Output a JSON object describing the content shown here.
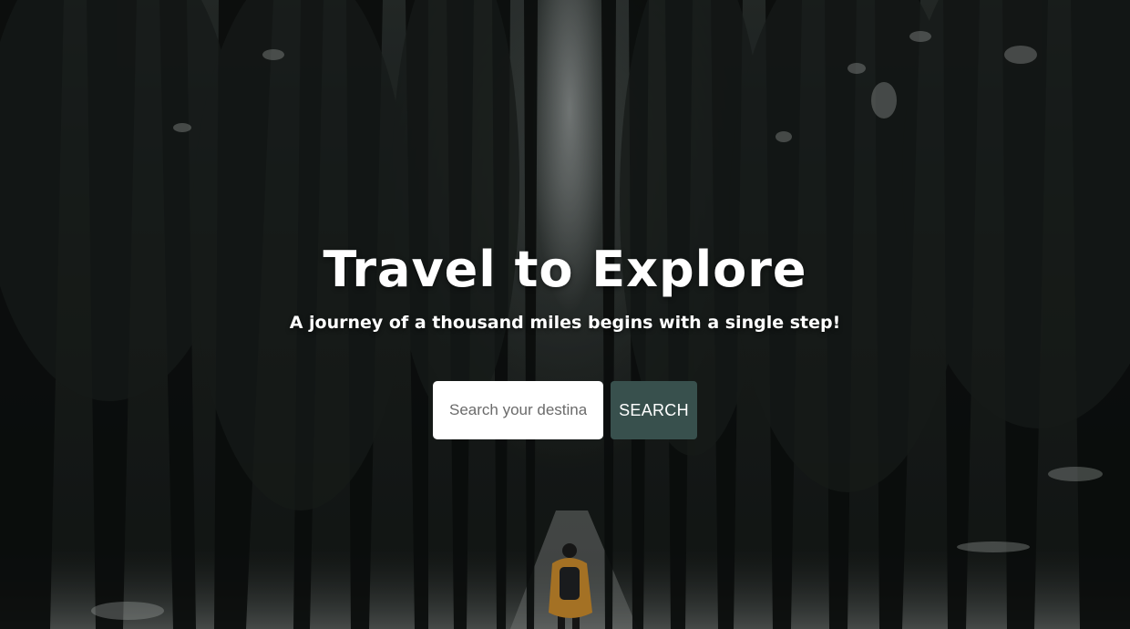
{
  "hero": {
    "title": "Travel to Explore",
    "subtitle": "A journey of a thousand miles begins with a single step!",
    "background": "snowy-forest-hiker-photo"
  },
  "search": {
    "placeholder": "Search your destination",
    "button_label": "SEARCH"
  },
  "colors": {
    "button_bg": "#38504d",
    "text": "#ffffff",
    "input_bg": "#ffffff"
  }
}
